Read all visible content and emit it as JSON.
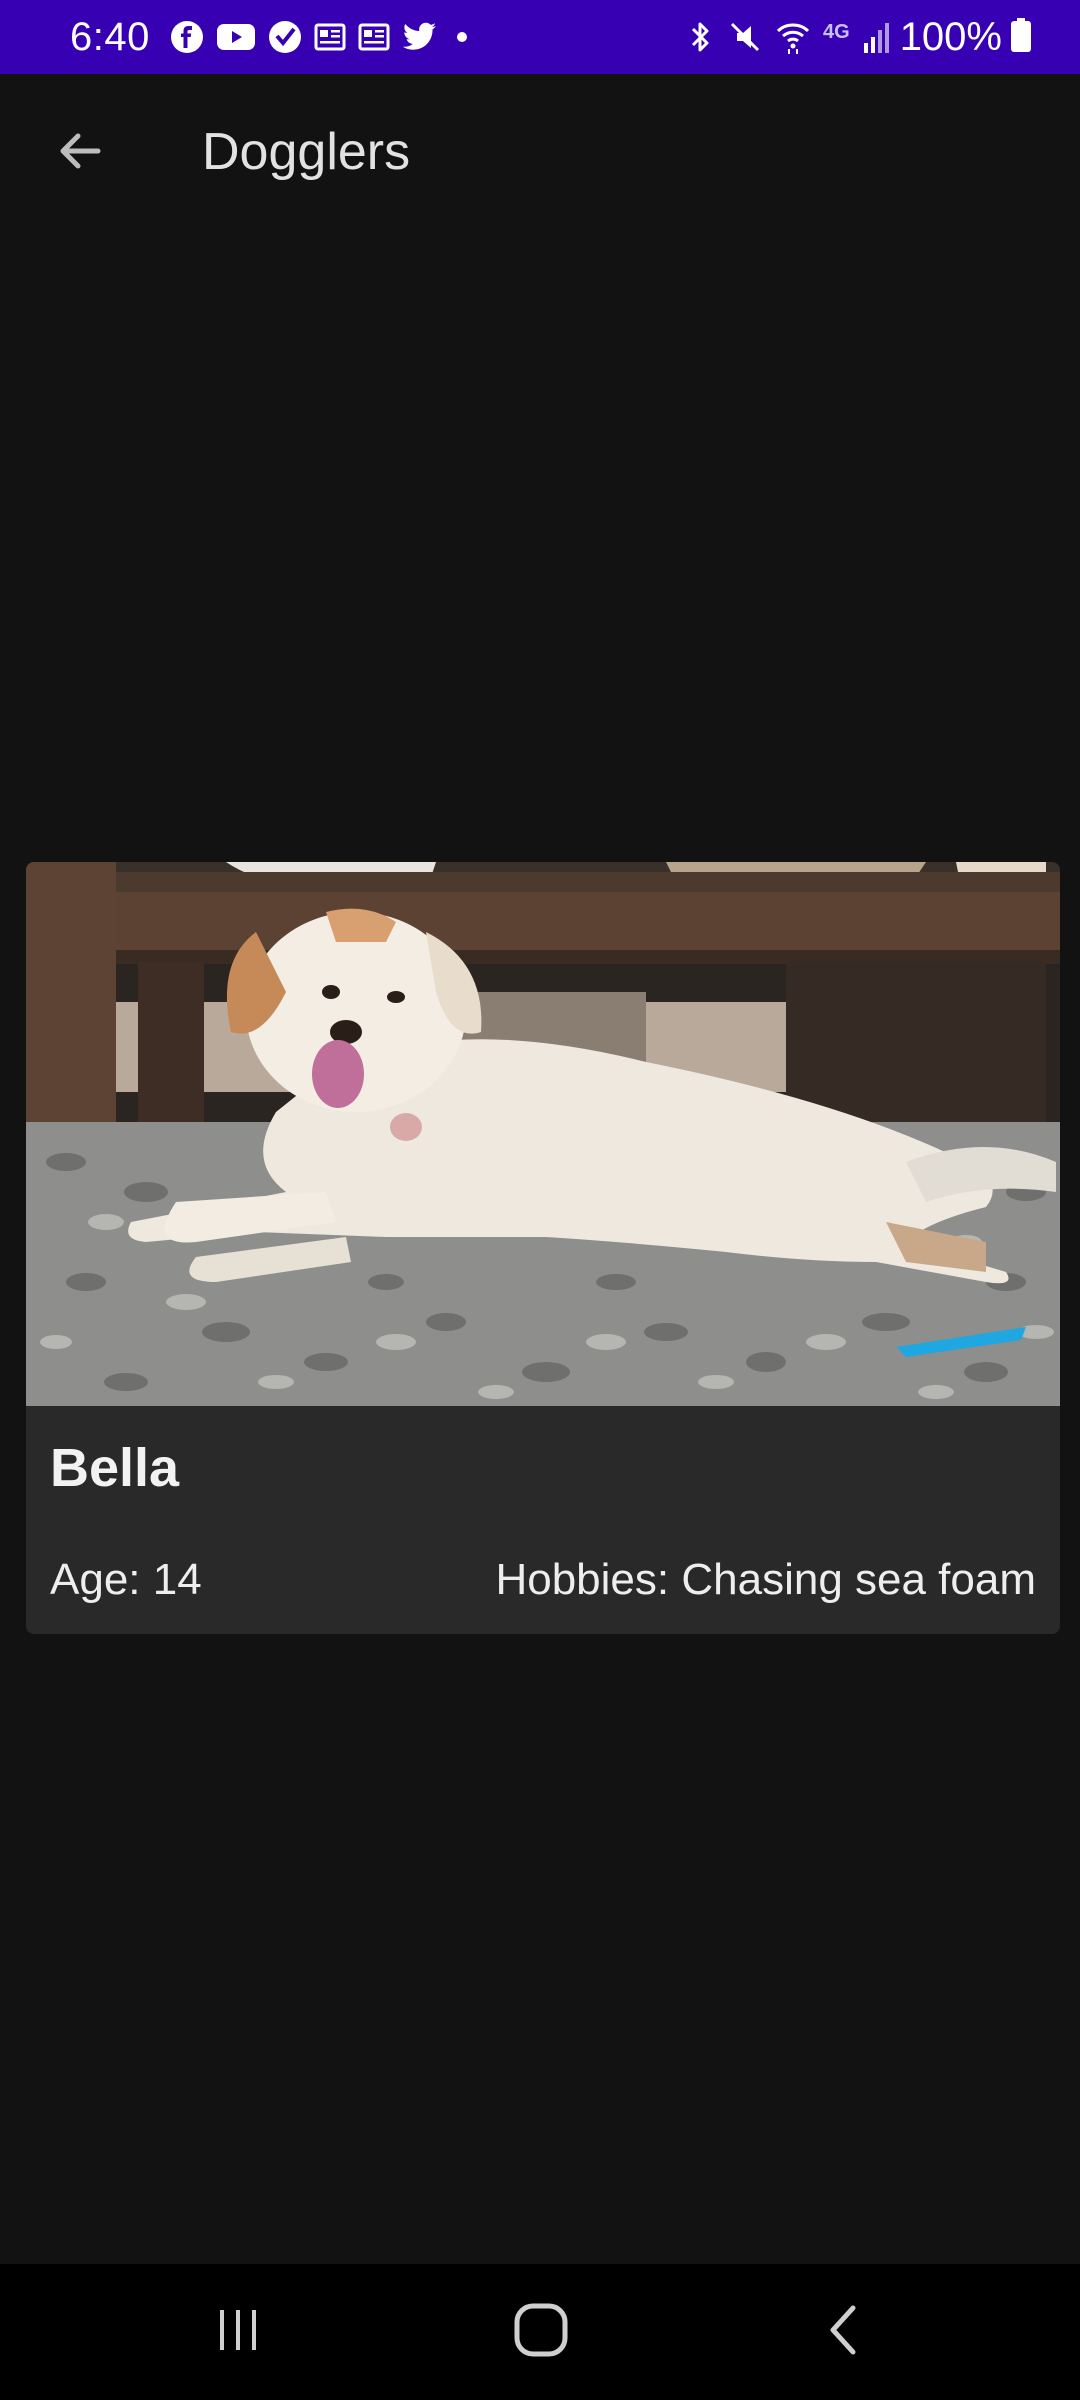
{
  "status_bar": {
    "time": "6:40",
    "notification_icons": [
      "facebook-icon",
      "youtube-icon",
      "verizon-icon",
      "news-icon",
      "news-icon",
      "twitter-icon",
      "dot-icon"
    ],
    "system_icons": [
      "bluetooth-icon",
      "mute-icon",
      "wifi-icon",
      "4g-icon",
      "signal-icon"
    ],
    "network_label": "4G",
    "battery_percent": "100%"
  },
  "app_bar": {
    "back_icon": "arrow-back-icon",
    "title": "Dogglers"
  },
  "dog_card": {
    "image_icon": "dog-photo",
    "name": "Bella",
    "age_text": "Age: 14",
    "hobbies_text": "Hobbies: Chasing sea foam"
  },
  "nav_bar": {
    "recents_icon": "recents-icon",
    "home_icon": "home-icon",
    "back_icon": "back-chevron-icon"
  },
  "colors": {
    "status_bar": "#3700b3",
    "background": "#121212",
    "card": "#292929",
    "nav_bar": "#000000"
  }
}
